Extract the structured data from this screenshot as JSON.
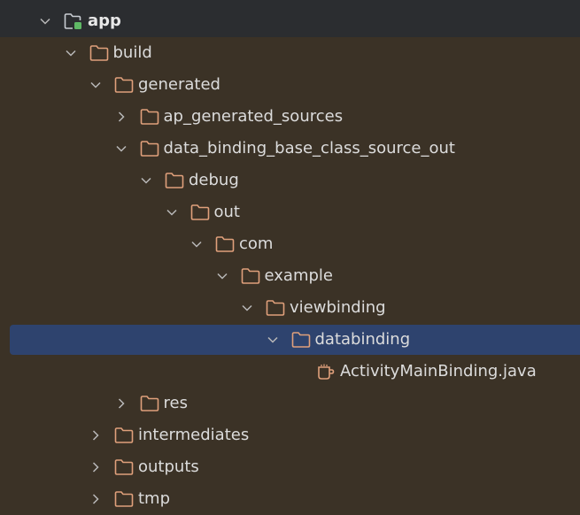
{
  "theme": {
    "background": "#3b3226",
    "header_band": "#2b2d30",
    "selection": "#2e436e",
    "folder_color": "#e0a07b",
    "module_icon_color": "#c9cdd3",
    "module_badge": "#5fb865",
    "chevron_color": "#b8b8b8",
    "text_color": "#dcdcdc"
  },
  "tree": [
    {
      "label": "app",
      "depth": 0,
      "chevron": "down",
      "icon": "module-folder-icon",
      "bold": true
    },
    {
      "label": "build",
      "depth": 1,
      "chevron": "down",
      "icon": "folder-icon"
    },
    {
      "label": "generated",
      "depth": 2,
      "chevron": "down",
      "icon": "folder-icon"
    },
    {
      "label": "ap_generated_sources",
      "depth": 3,
      "chevron": "right",
      "icon": "folder-icon"
    },
    {
      "label": "data_binding_base_class_source_out",
      "depth": 3,
      "chevron": "down",
      "icon": "folder-icon"
    },
    {
      "label": "debug",
      "depth": 4,
      "chevron": "down",
      "icon": "folder-icon"
    },
    {
      "label": "out",
      "depth": 5,
      "chevron": "down",
      "icon": "folder-icon"
    },
    {
      "label": "com",
      "depth": 6,
      "chevron": "down",
      "icon": "folder-icon"
    },
    {
      "label": "example",
      "depth": 7,
      "chevron": "down",
      "icon": "folder-icon"
    },
    {
      "label": "viewbinding",
      "depth": 8,
      "chevron": "down",
      "icon": "folder-icon"
    },
    {
      "label": "databinding",
      "depth": 9,
      "chevron": "down",
      "icon": "folder-icon",
      "selected": true
    },
    {
      "label": "ActivityMainBinding.java",
      "depth": 10,
      "chevron": "none",
      "icon": "java-class-icon"
    },
    {
      "label": "res",
      "depth": 3,
      "chevron": "right",
      "icon": "folder-icon"
    },
    {
      "label": "intermediates",
      "depth": 2,
      "chevron": "right",
      "icon": "folder-icon"
    },
    {
      "label": "outputs",
      "depth": 2,
      "chevron": "right",
      "icon": "folder-icon"
    },
    {
      "label": "tmp",
      "depth": 2,
      "chevron": "right",
      "icon": "folder-icon"
    }
  ]
}
